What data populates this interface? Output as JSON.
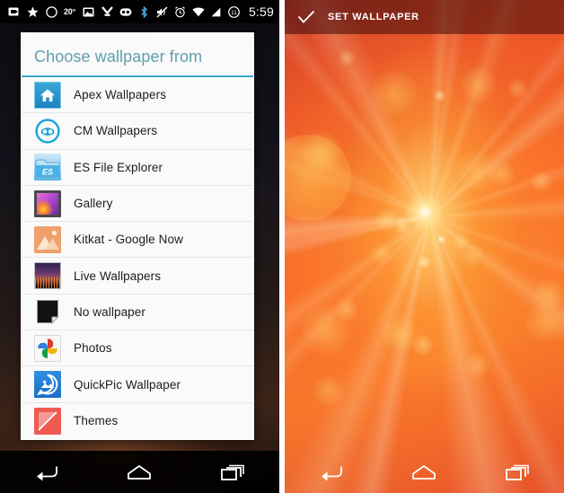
{
  "left_phone": {
    "status_bar": {
      "icons_left": [
        "sdcard-icon",
        "star-icon",
        "circle-icon",
        "screenshot-icon",
        "download-arrow-icon",
        "cyanogenmod-icon"
      ],
      "temperature": "20°",
      "icons_right": [
        "bluetooth-icon",
        "mute-icon",
        "alarm-icon",
        "wifi-icon",
        "signal-icon",
        "battery-icon"
      ],
      "clock": "5:59"
    },
    "dialog": {
      "title": "Choose wallpaper from",
      "items": [
        {
          "label": "Apex Wallpapers",
          "icon": "apex-wallpapers-icon"
        },
        {
          "label": "CM Wallpapers",
          "icon": "cm-wallpapers-icon"
        },
        {
          "label": "ES File Explorer",
          "icon": "es-file-explorer-icon"
        },
        {
          "label": "Gallery",
          "icon": "gallery-icon"
        },
        {
          "label": "Kitkat - Google Now",
          "icon": "kitkat-google-now-icon"
        },
        {
          "label": "Live Wallpapers",
          "icon": "live-wallpapers-icon"
        },
        {
          "label": "No wallpaper",
          "icon": "no-wallpaper-icon"
        },
        {
          "label": "Photos",
          "icon": "photos-icon"
        },
        {
          "label": "QuickPic Wallpaper",
          "icon": "quickpic-wallpaper-icon"
        },
        {
          "label": "Themes",
          "icon": "themes-icon"
        }
      ]
    },
    "nav_bar": {
      "back": "back-icon",
      "home": "home-icon",
      "recents": "recents-icon"
    }
  },
  "right_phone": {
    "action_bar": {
      "check": "check-icon",
      "label": "SET WALLPAPER"
    },
    "nav_bar": {
      "back": "back-icon",
      "home": "home-icon",
      "recents": "recents-icon"
    }
  },
  "colors": {
    "dialog_title": "#5f9ead",
    "dialog_divider": "#3aa6cf",
    "dialog_bg": "#fafafa",
    "list_text": "#1c1c1c",
    "status_bar_bg": "#000000",
    "wallpaper_orange": "#f96a2c",
    "wallpaper_red": "#c4342a",
    "wallpaper_yellow": "#ffeb96"
  }
}
